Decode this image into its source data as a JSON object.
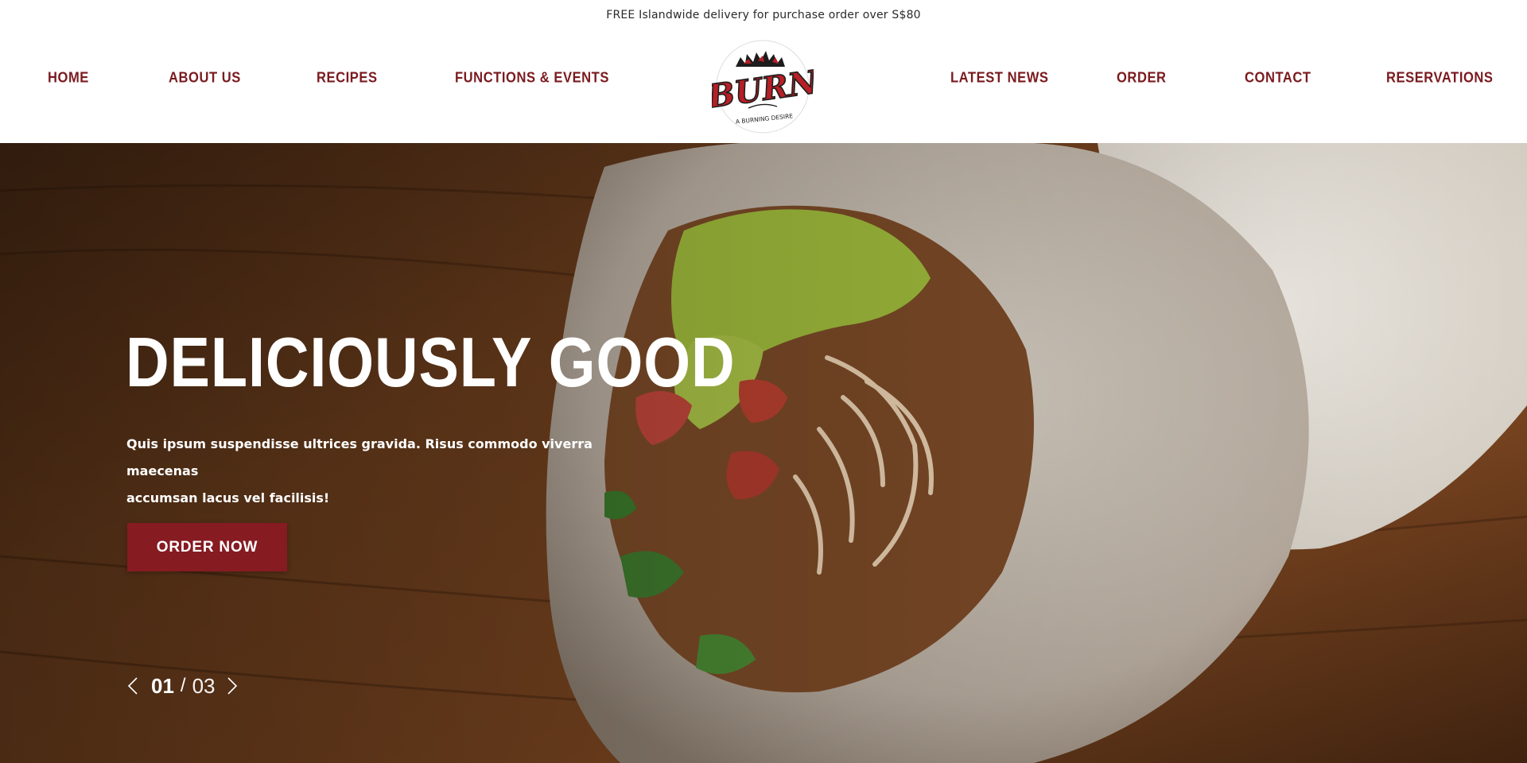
{
  "announcement": "FREE Islandwide delivery for purchase order over S$80",
  "nav": {
    "left": [
      "HOME",
      "ABOUT US",
      "RECIPES",
      "FUNCTIONS & EVENTS"
    ],
    "right": [
      "LATEST NEWS",
      "ORDER",
      "CONTACT",
      "RESERVATIONS"
    ]
  },
  "logo": {
    "wordmark": "BURN",
    "tagline": "A BURNING DESIRE"
  },
  "hero": {
    "title": "DELICIOUSLY GOOD",
    "subtitle_line1": "Quis ipsum suspendisse ultrices gravida. Risus commodo viverra maecenas",
    "subtitle_line2": "accumsan lacus vel facilisis!",
    "cta": "ORDER NOW",
    "slide_current": "01",
    "slide_separator": "/",
    "slide_total": "03"
  },
  "icons": {
    "prev": "chevron-left-icon",
    "next": "chevron-right-icon"
  },
  "colors": {
    "brand": "#7a1a1f",
    "button": "#861b22",
    "wood": "#6b3d1f",
    "text_light": "#ffffff"
  }
}
